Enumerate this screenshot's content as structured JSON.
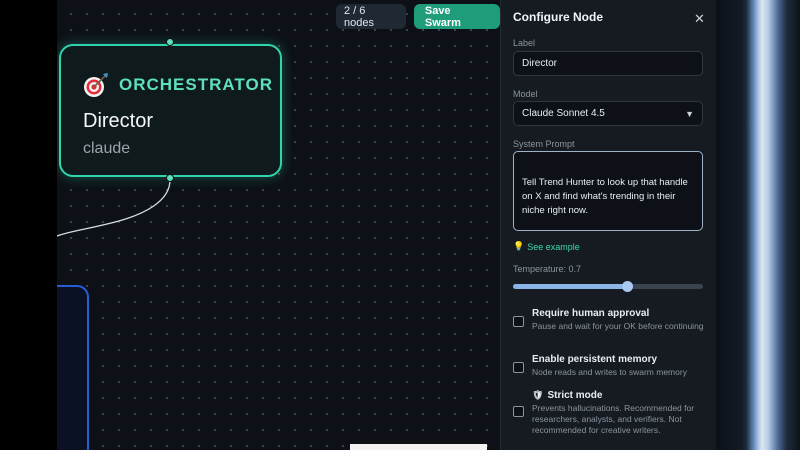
{
  "canvas": {
    "node_count": "2 / 6 nodes",
    "save_label": "Save Swarm",
    "orchestrator": {
      "icon": "target-icon",
      "role": "ORCHESTRATOR",
      "name": "Director",
      "model": "claude"
    }
  },
  "panel": {
    "title": "Configure Node",
    "label_label": "Label",
    "label_value": "Director",
    "model_label": "Model",
    "model_value": "Claude Sonnet 4.5",
    "prompt_label": "System Prompt",
    "prompt_value": "Tell Trend Hunter to look up that handle on X and find what's trending in their niche right now.\n\nTell Voice Analyst to look up that handle and figure out how the",
    "see_example": "See example",
    "temperature_label": "Temperature: 0.7",
    "temperature_value": 0.7,
    "options": [
      {
        "title": "Require human approval",
        "desc": "Pause and wait for your OK before continuing",
        "checked": false
      },
      {
        "title": "Enable persistent memory",
        "desc": "Node reads and writes to swarm memory",
        "checked": false
      },
      {
        "title": "Strict mode",
        "desc": "Prevents hallucinations. Recommended for researchers, analysts, and verifiers. Not recommended for creative writers.",
        "checked": false,
        "icon": "shield-icon"
      }
    ]
  },
  "colors": {
    "accent": "#2fd3ac",
    "save_button": "#1f9d7b",
    "link": "#3dd6b0",
    "blue_node": "#2a5bd7"
  }
}
